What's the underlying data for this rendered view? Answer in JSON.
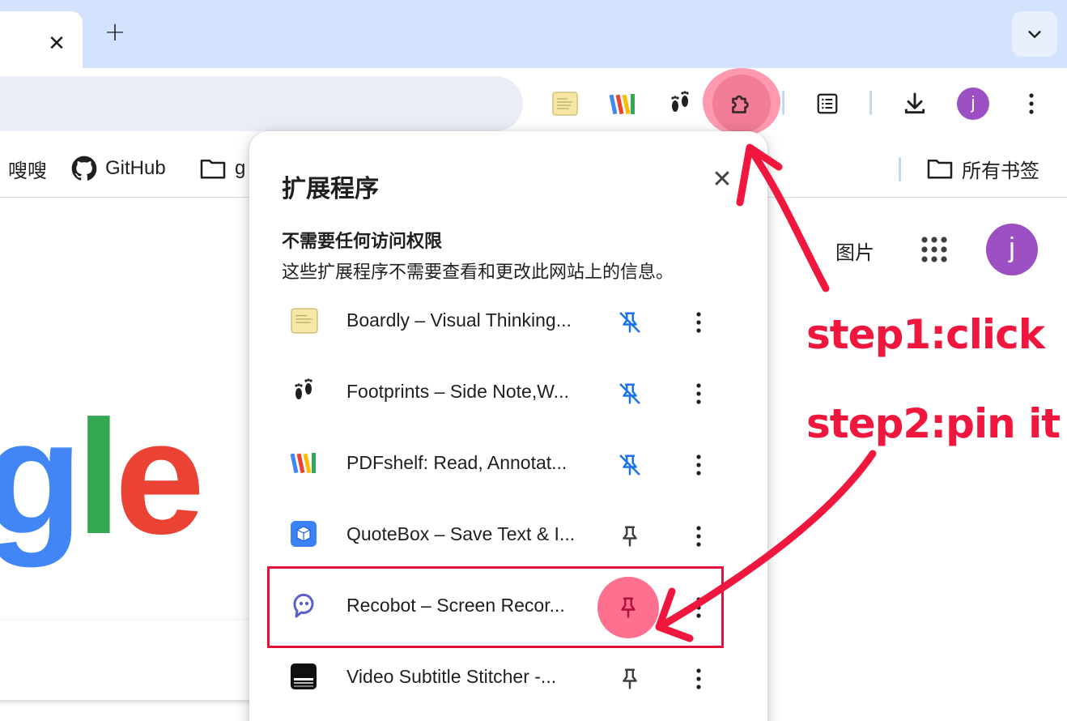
{
  "tabstrip": {
    "close_icon": "close-icon",
    "new_tab_icon": "plus-icon",
    "tab_search_icon": "chevron-down-icon",
    "close_glyph": "✕",
    "plus_glyph": "+"
  },
  "toolbar": {
    "extensions_pinned": [
      "boardly-icon",
      "pdfshelf-icon",
      "footprints-icon"
    ],
    "extensions_menu_icon": "puzzle-icon",
    "reading_list_icon": "reading-list-icon",
    "download_icon": "download-icon",
    "profile_initial": "j",
    "menu_icon": "kebab-icon"
  },
  "bookmarks": {
    "items": [
      {
        "label": "嗖嗖",
        "icon": "none"
      },
      {
        "label": "GitHub",
        "icon": "github-icon"
      },
      {
        "label": "g",
        "icon": "folder-icon"
      }
    ],
    "all_bookmarks": {
      "label": "所有书签",
      "icon": "folder-icon"
    }
  },
  "page": {
    "images_link": "图片",
    "apps_icon": "apps-grid-icon",
    "avatar_initial": "j",
    "logo_fragment": {
      "g": "g",
      "l": "l",
      "e": "e",
      "colors": {
        "g": "#4285f4",
        "l": "#34a853",
        "e": "#ea4335"
      }
    }
  },
  "popup": {
    "title": "扩展程序",
    "close_icon": "close-icon",
    "section_heading": "不需要任何访问权限",
    "section_desc": "这些扩展程序不需要查看和更改此网站上的信息。",
    "extensions": [
      {
        "name": "Boardly – Visual Thinking...",
        "icon": "boardly-icon",
        "pinned": true
      },
      {
        "name": "Footprints – Side Note,W...",
        "icon": "footprints-icon",
        "pinned": true
      },
      {
        "name": "PDFshelf: Read, Annotat...",
        "icon": "pdfshelf-icon",
        "pinned": true
      },
      {
        "name": "QuoteBox – Save Text & I...",
        "icon": "quotebox-icon",
        "pinned": false
      },
      {
        "name": "Recobot – Screen Recor...",
        "icon": "recobot-icon",
        "pinned": false
      },
      {
        "name": "Video Subtitle Stitcher -...",
        "icon": "video-subtitle-icon",
        "pinned": false
      }
    ]
  },
  "annotations": {
    "step1": "step1:click",
    "step2": "step2:pin it",
    "color": "#f0173f"
  }
}
